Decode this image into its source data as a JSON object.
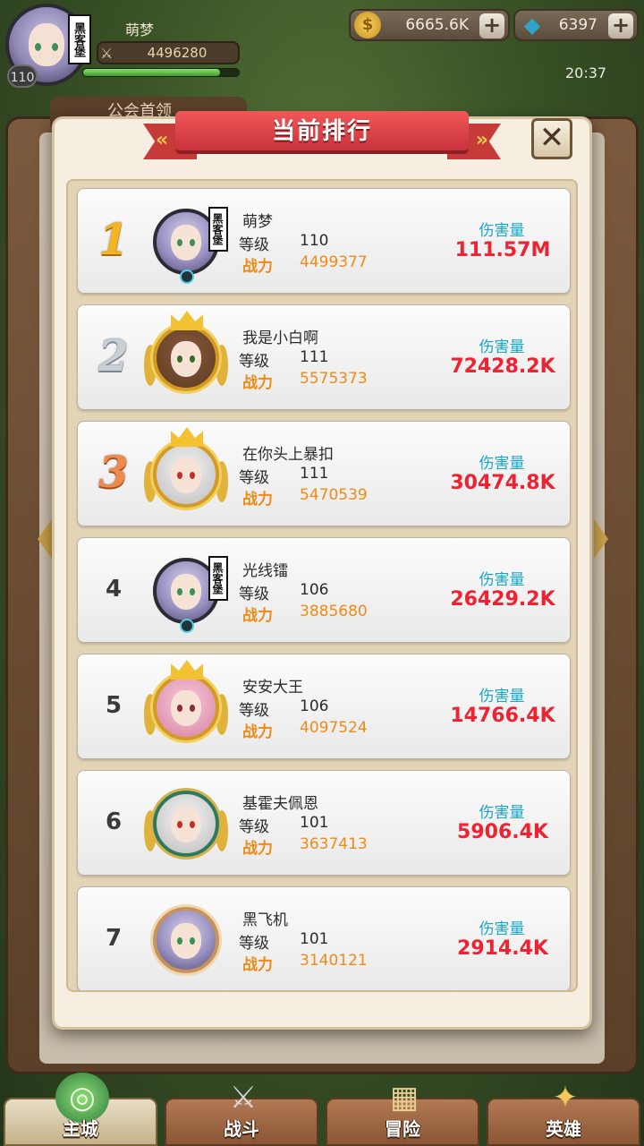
{
  "hud": {
    "player_level": "110",
    "player_name": "萌梦",
    "power": "4496280",
    "avatar_tag": "黑客堡",
    "gold": "6665.6K",
    "gems": "6397",
    "time": "20:37",
    "exp_fraction": 0.88
  },
  "background_tab": "公会首领",
  "dialog": {
    "title": "当前排行",
    "close_symbol": "✕",
    "level_label": "等级",
    "power_label": "战力",
    "damage_label": "伤害量"
  },
  "rankings": [
    {
      "rank": "1",
      "name": "萌梦",
      "level": "110",
      "power": "4499377",
      "damage": "111.57M",
      "tag": "黑客堡"
    },
    {
      "rank": "2",
      "name": "我是小白啊",
      "level": "111",
      "power": "5575373",
      "damage": "72428.2K"
    },
    {
      "rank": "3",
      "name": "在你头上暴扣",
      "level": "111",
      "power": "5470539",
      "damage": "30474.8K"
    },
    {
      "rank": "4",
      "name": "光线镭",
      "level": "106",
      "power": "3885680",
      "damage": "26429.2K",
      "tag": "黑客堡"
    },
    {
      "rank": "5",
      "name": "安安大王",
      "level": "106",
      "power": "4097524",
      "damage": "14766.4K"
    },
    {
      "rank": "6",
      "name": "基霍夫佩恩",
      "level": "101",
      "power": "3637413",
      "damage": "5906.4K"
    },
    {
      "rank": "7",
      "name": "黑飞机",
      "level": "101",
      "power": "3140121",
      "damage": "2914.4K"
    }
  ],
  "nav": [
    {
      "label": "主城",
      "icon": "city-icon"
    },
    {
      "label": "战斗",
      "icon": "crossed-swords-icon"
    },
    {
      "label": "冒险",
      "icon": "adventure-map-icon"
    },
    {
      "label": "英雄",
      "icon": "hero-emblem-icon"
    }
  ],
  "colors": {
    "ribbon": "#c8323a",
    "damage_value": "#ef2232",
    "damage_label": "#18a6c9",
    "power": "#f08a16"
  }
}
